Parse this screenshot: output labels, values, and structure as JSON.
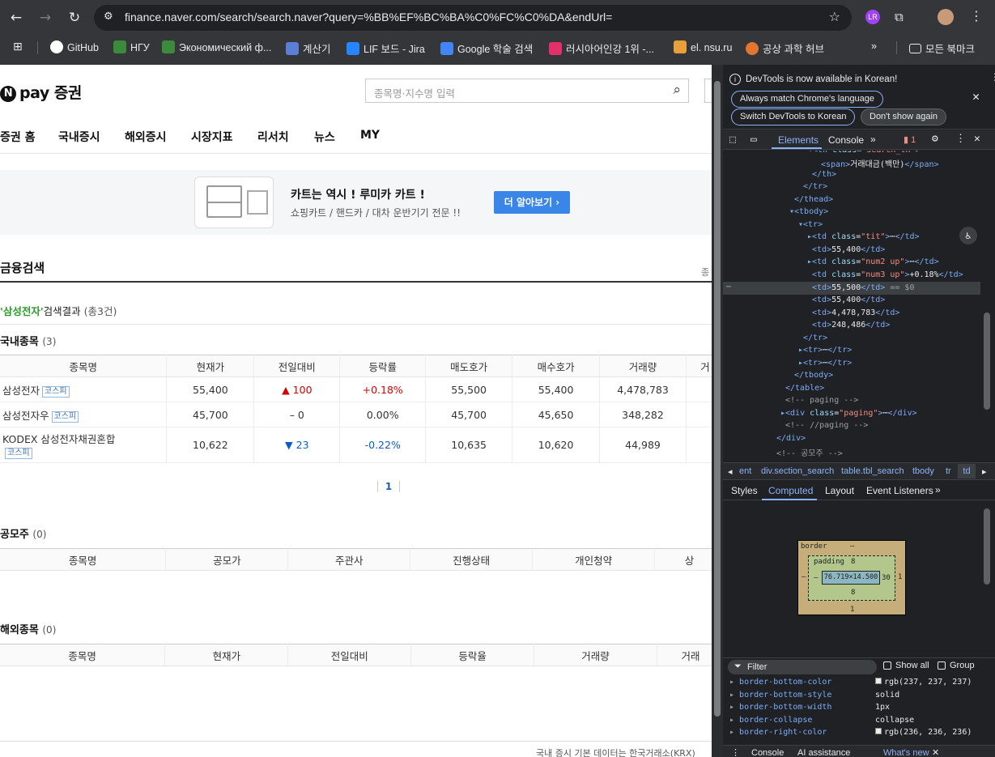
{
  "browser": {
    "url": "finance.naver.com/search/search.naver?query=%BB%EF%BC%BA%C0%FC%C0%DA&endUrl=",
    "bookmarks": [
      "GitHub",
      "НГУ",
      "Экономический ф...",
      "계산기",
      "LIF 보드 - Jira",
      "Google 학술 검색",
      "러시아어인강 1위 -...",
      "el. nsu.ru",
      "공상 과학 허브"
    ],
    "all_bookmarks": "모든 북마크",
    "icons": {
      "back": "back-arrow-icon",
      "forward": "forward-arrow-icon",
      "reload": "reload-icon",
      "site_info": "tune-icon",
      "star": "star-icon",
      "profile": "profile-icon",
      "extensions": "puzzle-icon",
      "menu": "kebab-icon"
    }
  },
  "site": {
    "logo_pay": "pay 증권",
    "logo_n": "N",
    "search_placeholder": "종목명·지수명 입력",
    "nav": [
      "증권 홈",
      "국내증시",
      "해외증시",
      "시장지표",
      "리서치",
      "뉴스",
      "MY"
    ],
    "banner": {
      "title": "카트는 역시 ! 루미카 카트 !",
      "subtitle": "쇼핑카트 / 핸드카 / 대차 운반기기 전문 !!",
      "button": "더 알아보기 ›"
    },
    "section_title": "금융검색",
    "result_query": "'삼성전자'",
    "result_suffix": "검색결과",
    "result_count": "(총3건)",
    "domestic": {
      "title": "국내종목",
      "count": "(3)",
      "headers": [
        "종목명",
        "현재가",
        "전일대비",
        "등락률",
        "매도호가",
        "매수호가",
        "거래량",
        "거"
      ],
      "rows": [
        {
          "name": "삼성전자",
          "market": "코스피",
          "price": "55,400",
          "change": "▲ 100",
          "dir": "up",
          "rate": "+0.18%",
          "ask": "55,500",
          "bid": "55,400",
          "volume": "4,478,783"
        },
        {
          "name": "삼성전자우",
          "market": "코스피",
          "price": "45,700",
          "change": "– 0",
          "dir": "flat",
          "rate": "0.00%",
          "ask": "45,700",
          "bid": "45,650",
          "volume": "348,282"
        },
        {
          "name": "KODEX 삼성전자채권혼합",
          "market": "코스피",
          "price": "10,622",
          "change": "▼ 23",
          "dir": "down",
          "rate": "-0.22%",
          "ask": "10,635",
          "bid": "10,620",
          "volume": "44,989"
        }
      ],
      "page": "1"
    },
    "ipo": {
      "title": "공모주",
      "count": "(0)",
      "headers": [
        "종목명",
        "공모가",
        "주관사",
        "진행상태",
        "개인청약",
        "상"
      ]
    },
    "overseas": {
      "title": "해외종목",
      "count": "(0)",
      "headers": [
        "종목명",
        "현재가",
        "전일대비",
        "등락율",
        "거래량",
        "거래"
      ]
    },
    "footer": "국내 증시 기본 데이터는 한국거래소(KRX)",
    "side_note": "종"
  },
  "devtools": {
    "notice": "DevTools is now available in Korean!",
    "notice_buttons": [
      "Always match Chrome's language",
      "Switch DevTools to Korean",
      "Don't show again"
    ],
    "tabs": [
      "Elements",
      "Console"
    ],
    "issues_count": "1",
    "dom_lines": [
      {
        "indent": 0,
        "html": "<span class='tg'>&lt;th</span> <span class='at'>class</span>=<span class='av'>\"search_th\"</span><span class='tg'>&gt;</span>"
      },
      {
        "indent": 1,
        "html": "<span class='tg'>&lt;span&gt;</span>거래대금(백만)<span class='tg'>&lt;/span&gt;</span>"
      },
      {
        "indent": 0,
        "html": "<span class='tg'>&lt;/th&gt;</span>"
      }
    ],
    "selected_suffix": "== $0",
    "breadcrumbs": [
      "ent",
      "div.section_search",
      "table.tbl_search",
      "tbody",
      "tr",
      "td"
    ],
    "sub_tabs": [
      "Styles",
      "Computed",
      "Layout",
      "Event Listeners"
    ],
    "box": {
      "border": "border",
      "border_val": "–",
      "padding": "padding",
      "padding_top": "8",
      "padding_bottom": "8",
      "padding_left": "–",
      "padding_right": "30",
      "content": "76.719×14.500",
      "margin_left": "–",
      "margin_right": "1",
      "margin_bottom": "1"
    },
    "filter_placeholder": "Filter",
    "show_all": "Show all",
    "group": "Group",
    "props": [
      {
        "name": "border-bottom-color",
        "value": "rgb(237, 237, 237)",
        "swatch": "#ededed"
      },
      {
        "name": "border-bottom-style",
        "value": "solid"
      },
      {
        "name": "border-bottom-width",
        "value": "1px"
      },
      {
        "name": "border-collapse",
        "value": "collapse"
      },
      {
        "name": "border-right-color",
        "value": "rgb(236, 236, 236)",
        "swatch": "#ececec"
      }
    ],
    "drawer_tabs": [
      "Console",
      "AI assistance",
      "What's new"
    ]
  }
}
